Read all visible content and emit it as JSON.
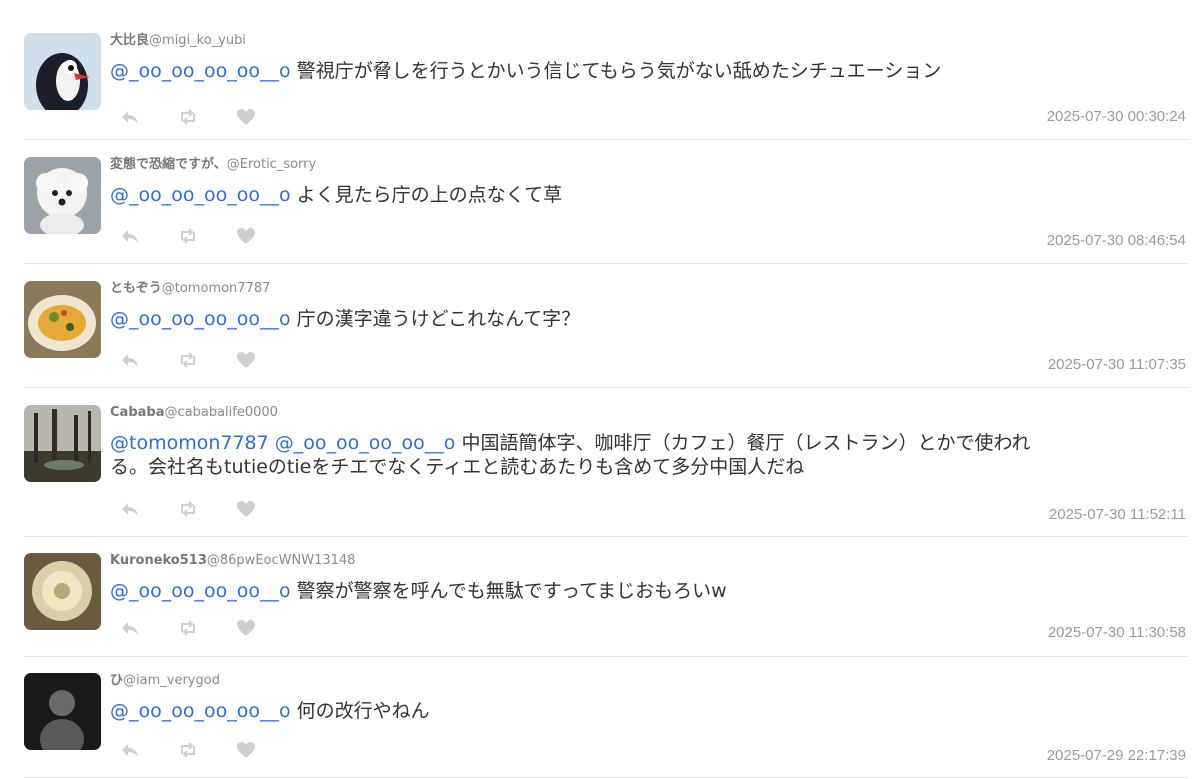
{
  "posts": [
    {
      "display_name": "大比良",
      "handle": "@migi_ko_yubi",
      "mentions": "@_oo_oo_oo_oo__o",
      "text": "警視庁が脅しを行うとかいう信じてもらう気がない舐めたシチュエーション",
      "timestamp": "2025-07-30 00:30:24",
      "avatar": "penguin-avatar"
    },
    {
      "display_name": "変態で恐縮ですが、",
      "handle": "@Erotic_sorry",
      "mentions": "@_oo_oo_oo_oo__o",
      "text": "よく見たら庁の上の点なくて草",
      "timestamp": "2025-07-30 08:46:54",
      "avatar": "white-dog-avatar"
    },
    {
      "display_name": "ともぞう",
      "handle": "@tomomon7787",
      "mentions": "@_oo_oo_oo_oo__o",
      "text": "庁の漢字違うけどこれなんて字？",
      "timestamp": "2025-07-30 11:07:35",
      "avatar": "food-avatar"
    },
    {
      "display_name": "Cababa",
      "handle": "@cababalife0000",
      "mentions": "@tomomon7787 @_oo_oo_oo_oo__o",
      "text_line1": "中国語簡体字、咖啡厅（カフェ）餐厅（レストラン）とかで使われ",
      "text_line2": "る。会社名もtutieのtieをチエでなくティエと読むあたりも含めて多分中国人だね",
      "timestamp": "2025-07-30 11:52:11",
      "avatar": "forest-avatar"
    },
    {
      "display_name": "Kuroneko513",
      "handle": "@86pwEocWNW13148",
      "mentions": "@_oo_oo_oo_oo__o",
      "text": "警察が警察を呼んでも無駄ですってまじおもろいw",
      "timestamp": "2025-07-30 11:30:58",
      "avatar": "dandelion-avatar"
    },
    {
      "display_name": "ひ",
      "handle": "@iam_verygod",
      "mentions": "@_oo_oo_oo_oo__o",
      "text": "何の改行やねん",
      "timestamp": "2025-07-29 22:17:39",
      "avatar": "dark-figure-avatar"
    }
  ],
  "icons": {
    "reply": "reply-icon",
    "retweet": "retweet-icon",
    "like": "heart-icon"
  },
  "colors": {
    "mention": "#2f6fd1",
    "muted": "#9a9a9a",
    "icon": "#cfcfcf",
    "divider": "#e6e6e6"
  }
}
